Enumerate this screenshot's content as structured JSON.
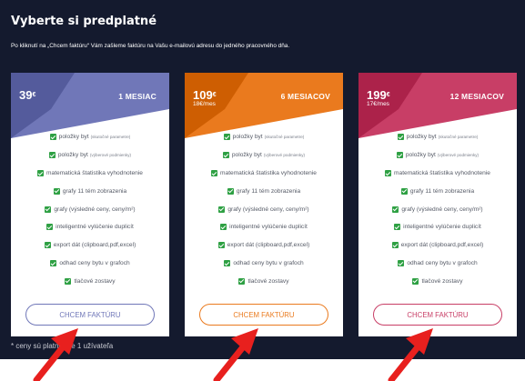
{
  "header": {
    "title": "Vyberte si predplatné",
    "subtitle": "Po kliknutí na „Chcem faktúru“ Vám zašleme faktúru na Vašu e-mailovú adresu do jedného pracovného dňa."
  },
  "plans": [
    {
      "price": "39",
      "currency": "€",
      "per_month": "",
      "name": "1 MESIAC",
      "cta": "CHCEM FAKTÚRU",
      "accent": "#7077b8"
    },
    {
      "price": "109",
      "currency": "€",
      "per_month": "18€/mes",
      "name": "6 MESIACOV",
      "cta": "CHCEM FAKTÚRU",
      "accent": "#ea7a1e"
    },
    {
      "price": "199",
      "currency": "€",
      "per_month": "17€/mes",
      "name": "12 MESIACOV",
      "cta": "CHCEM FAKTÚRU",
      "accent": "#c83e66"
    }
  ],
  "features": [
    {
      "text": "položky byt",
      "note": "(skutočné parametre)"
    },
    {
      "text": "položky byt",
      "note": "(výberové podmienky)"
    },
    {
      "text": "matematická štatistika vyhodnotenie",
      "note": ""
    },
    {
      "text": "grafy 11 tém zobrazenia",
      "note": ""
    },
    {
      "text": "grafy (výsledné ceny, ceny/m²)",
      "note": ""
    },
    {
      "text": "inteligentné vylúčenie duplicít",
      "note": ""
    },
    {
      "text": "export dát (clipboard,pdf,excel)",
      "note": ""
    },
    {
      "text": "odhad ceny bytu v grafoch",
      "note": ""
    },
    {
      "text": "tlačové zostavy",
      "note": ""
    }
  ],
  "footnote": "* ceny sú platné pre 1 užívateľa",
  "colors": {
    "panel_background": "#141a2e",
    "check": "#2ea043",
    "arrow": "#e8201e"
  }
}
